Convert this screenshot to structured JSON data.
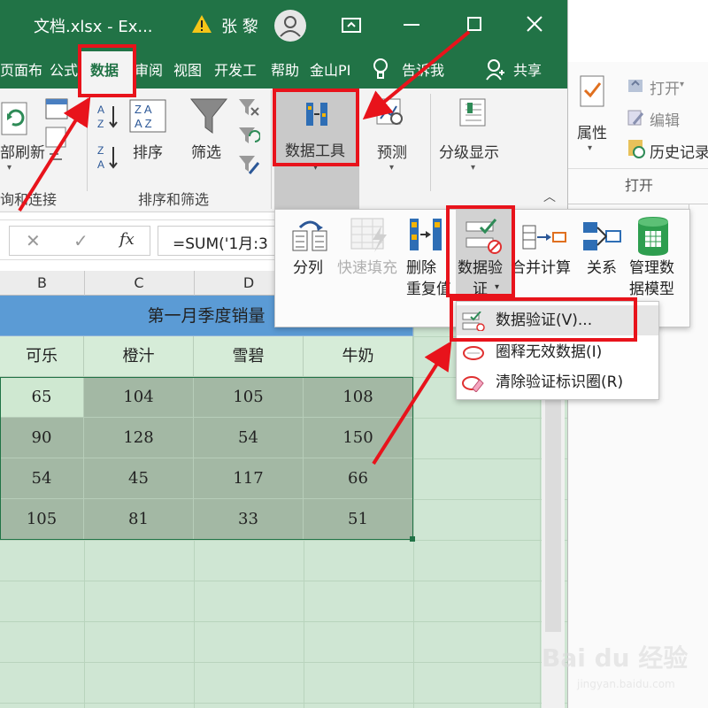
{
  "window": {
    "title": "文档.xlsx  -  Ex...",
    "user": "张 黎"
  },
  "tabs": [
    "页面布",
    "公式",
    "数据",
    "审阅",
    "视图",
    "开发工",
    "帮助",
    "金山PI",
    "告诉我",
    "共享"
  ],
  "ribbon": {
    "refresh_label": "部刷新",
    "sort_label": "排序",
    "filter_label": "筛选",
    "data_tools_label": "数据工具",
    "forecast_label": "预测",
    "outline_label": "分级显示",
    "group_query": "询和连接",
    "group_sort_filter": "排序和筛选"
  },
  "formula_bar": {
    "fx": "fx",
    "content": "=SUM('1月:3"
  },
  "columns": [
    "B",
    "C",
    "D"
  ],
  "sheet": {
    "merged_title": "第一月季度销量",
    "headers": [
      "可乐",
      "橙汁",
      "雪碧",
      "牛奶"
    ],
    "rows": [
      [
        "65",
        "104",
        "105",
        "108"
      ],
      [
        "90",
        "128",
        "54",
        "150"
      ],
      [
        "54",
        "45",
        "117",
        "66"
      ],
      [
        "105",
        "81",
        "33",
        "51"
      ]
    ]
  },
  "flyout": {
    "items": [
      "分列",
      "快速填充",
      "删除\n重复值",
      "数据验\n证",
      "合并计算",
      "关系",
      "管理数\n据模型"
    ],
    "menu": [
      "数据验证(V)...",
      "圈释无效数据(I)",
      "清除验证标识圈(R)"
    ]
  },
  "bg_window": {
    "properties": "属性",
    "open": "打开",
    "edit": "编辑",
    "history": "历史记录",
    "group_open": "打开"
  },
  "watermark": {
    "brand": "Bai du 经验",
    "url": "jingyan.baidu.com"
  },
  "colors": {
    "excel_green": "#217346",
    "annotation_red": "#e8131b",
    "title_band": "#5b9bd5",
    "header_fill": "#d6ecd8",
    "data_fill": "#a3b8a4"
  }
}
